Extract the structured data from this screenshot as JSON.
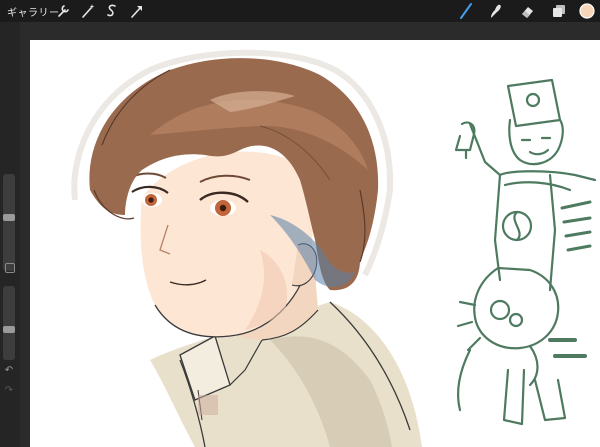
{
  "toolbar": {
    "gallery_label": "ギャラリー",
    "left_tools": [
      "wrench-icon",
      "magic-wand-icon",
      "selection-s-icon",
      "transform-arrow-icon"
    ],
    "right_tools": [
      "brush-icon",
      "smudge-icon",
      "eraser-icon",
      "layers-icon",
      "color-swatch"
    ],
    "active_tool": "brush-icon",
    "active_color": "#4a9be8",
    "current_color": "#f6d5b8"
  },
  "sidebar": {
    "brush_size_level": 0.55,
    "opacity_level": 0.4
  },
  "colors": {
    "hair": "#9a6a4e",
    "skin": "#fde6d4",
    "sketch": "#4e7a60",
    "shirt": "#e9e0cc"
  }
}
